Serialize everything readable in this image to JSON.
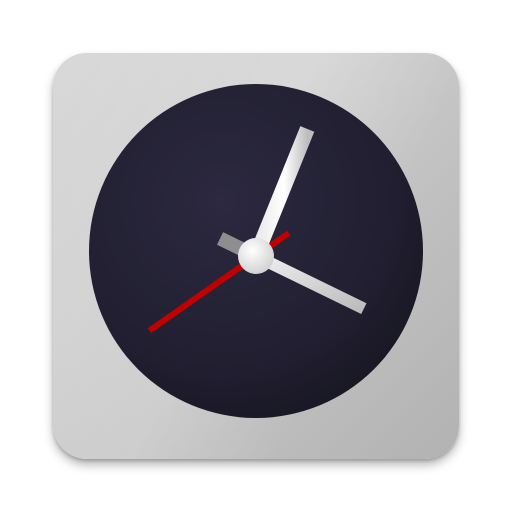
{
  "app": {
    "icon_name": "clock-app-icon",
    "colors": {
      "face": "#232134",
      "face_edge": "#151420",
      "hour_hand": "#8a8a8a",
      "minute_hand": "#f2f2f2",
      "second_hand": "#c40000",
      "center_cap": "#e6e6e6",
      "tile": "#cccccc"
    },
    "time_shown": {
      "hour": 4,
      "minute": 2,
      "second": 40
    }
  }
}
